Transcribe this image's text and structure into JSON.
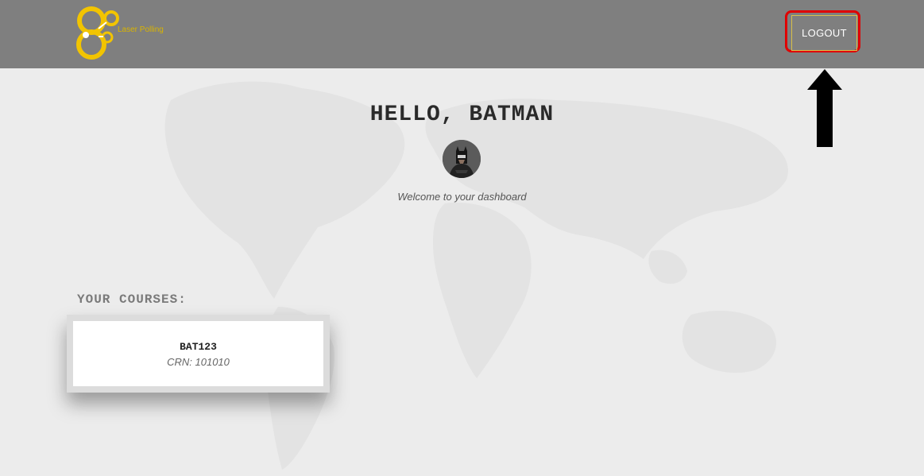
{
  "header": {
    "logo_text": "Laser Polling",
    "logout_label": "LOGOUT"
  },
  "colors": {
    "header_bg": "#7f7f7f",
    "page_bg": "#ececec",
    "logo_accent": "#f2c400",
    "highlight": "#e00000"
  },
  "icons": {
    "logo": "laser-polling-logo",
    "avatar": "batman-avatar",
    "annotation_arrow": "arrow-up-icon",
    "background": "world-map"
  },
  "main": {
    "greeting": "HELLO, BATMAN",
    "welcome": "Welcome to your dashboard"
  },
  "courses": {
    "heading": "YOUR COURSES:",
    "items": [
      {
        "code": "BAT123",
        "crn": "CRN: 101010"
      }
    ]
  }
}
